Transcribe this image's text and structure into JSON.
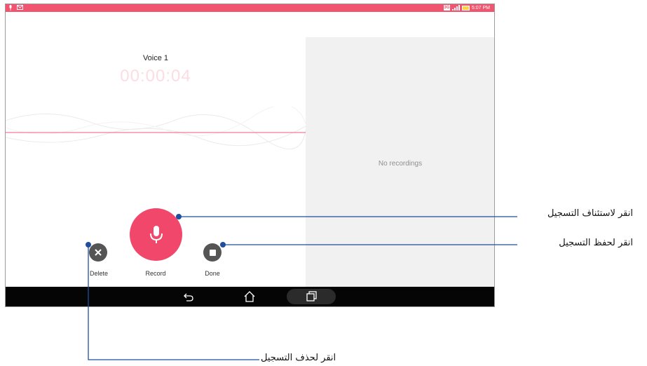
{
  "status_bar": {
    "time": "5:07 PM",
    "network_badge": "3G"
  },
  "recorder": {
    "recording_name": "Voice 1",
    "elapsed_time": "00:00:04"
  },
  "recordings_panel": {
    "empty_message": "No recordings"
  },
  "controls": {
    "delete_label": "Delete",
    "record_label": "Record",
    "done_label": "Done"
  },
  "callouts": {
    "resume": "انقر لاستئناف التسجيل",
    "save": "انقر لحفظ التسجيل",
    "delete": "انقر لحذف التسجيل"
  },
  "colors": {
    "status_bar": "#f0546f",
    "record_button": "#f0476b",
    "control_buttons": "#555555",
    "callout_line": "#1f4e9e",
    "nav_bar": "#050505",
    "recordings_panel_bg": "#f1f1f1"
  },
  "icons": {
    "status_left": [
      "mic-icon",
      "message-icon"
    ],
    "status_right": [
      "network-badge-icon",
      "signal-icon",
      "battery-icon"
    ],
    "record": "mic-icon",
    "delete": "close-icon",
    "done": "stop-icon",
    "nav": [
      "back-icon",
      "home-icon",
      "recent-apps-icon"
    ]
  }
}
